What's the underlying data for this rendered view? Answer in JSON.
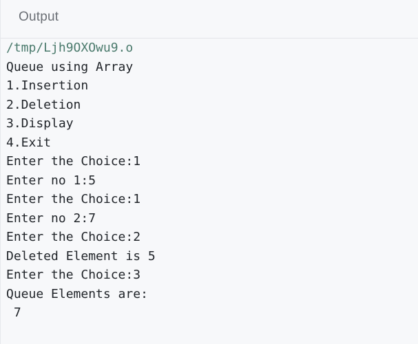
{
  "header": {
    "title": "Output"
  },
  "console": {
    "lines": [
      "/tmp/Ljh9OXOwu9.o",
      "Queue using Array",
      "1.Insertion",
      "2.Deletion",
      "3.Display",
      "4.Exit",
      "Enter the Choice:1",
      "Enter no 1:5",
      "Enter the Choice:1",
      "Enter no 2:7",
      "Enter the Choice:2",
      "Deleted Element is 5",
      "Enter the Choice:3",
      "Queue Elements are:",
      " 7"
    ]
  }
}
